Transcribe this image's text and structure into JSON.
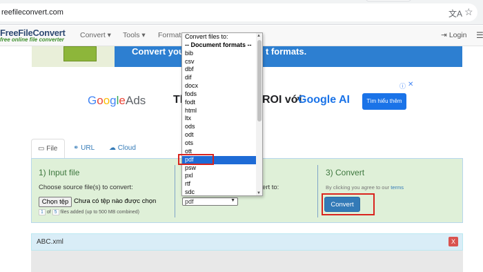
{
  "browser": {
    "url": "reefileconvert.com",
    "translate_icon": "translate-icon",
    "star_icon": "star-icon"
  },
  "nav": {
    "logo_main": "FreeFileConvert",
    "logo_sub": "free online file converter",
    "items": [
      {
        "label": "Convert ▾"
      },
      {
        "label": "Tools ▾"
      },
      {
        "label": "Formats"
      }
    ],
    "login": "Login",
    "menu_icon": "bars-icon"
  },
  "banner": {
    "text_left": "Convert you",
    "text_right": "t formats."
  },
  "ad": {
    "google_letters": [
      "G",
      "o",
      "o",
      "g",
      "l",
      "e"
    ],
    "ads_word": "Ads",
    "text_left": "Thúc",
    "text_right": "ROI với",
    "brand": "Google AI",
    "button": "Tìm hiểu thêm",
    "info": "ⓘ",
    "close": "✕"
  },
  "tabs": {
    "file": "File",
    "url": "URL",
    "cloud": "Cloud"
  },
  "step1": {
    "title": "1) Input file",
    "label": "Choose source file(s) to convert:",
    "choose_button": "Chọn tệp",
    "no_file": "Chưa có tệp nào được chọn",
    "count": "1",
    "of": "of",
    "max": "5",
    "files_added": "files added (up to 500 MB combined)"
  },
  "step2": {
    "label": "nvert to:",
    "selected_value": "pdf"
  },
  "step3": {
    "title": "3) Convert",
    "agree": "By clicking you agree to our",
    "terms": "terms",
    "convert_button": "Convert"
  },
  "file_row": {
    "name": "ABC.xml",
    "remove": "X"
  },
  "dropdown": {
    "options": [
      {
        "label": "Convert files to:",
        "kind": "plain"
      },
      {
        "label": "-- Document formats --",
        "kind": "header"
      },
      {
        "label": "bib",
        "kind": "plain"
      },
      {
        "label": "csv",
        "kind": "plain"
      },
      {
        "label": "dbf",
        "kind": "plain"
      },
      {
        "label": "dif",
        "kind": "plain"
      },
      {
        "label": "docx",
        "kind": "plain"
      },
      {
        "label": "fods",
        "kind": "plain"
      },
      {
        "label": "fodt",
        "kind": "plain"
      },
      {
        "label": "html",
        "kind": "plain"
      },
      {
        "label": "ltx",
        "kind": "plain"
      },
      {
        "label": "ods",
        "kind": "plain"
      },
      {
        "label": "odt",
        "kind": "plain"
      },
      {
        "label": "ots",
        "kind": "plain"
      },
      {
        "label": "ott",
        "kind": "plain"
      },
      {
        "label": "pdf",
        "kind": "selected"
      },
      {
        "label": "psw",
        "kind": "plain"
      },
      {
        "label": "pxl",
        "kind": "plain"
      },
      {
        "label": "rtf",
        "kind": "plain"
      },
      {
        "label": "sdc",
        "kind": "plain"
      }
    ]
  },
  "colors": {
    "accent": "#337ab7",
    "highlight": "#d9231d",
    "panel": "#dff0d8",
    "selected": "#1e6bd6"
  }
}
